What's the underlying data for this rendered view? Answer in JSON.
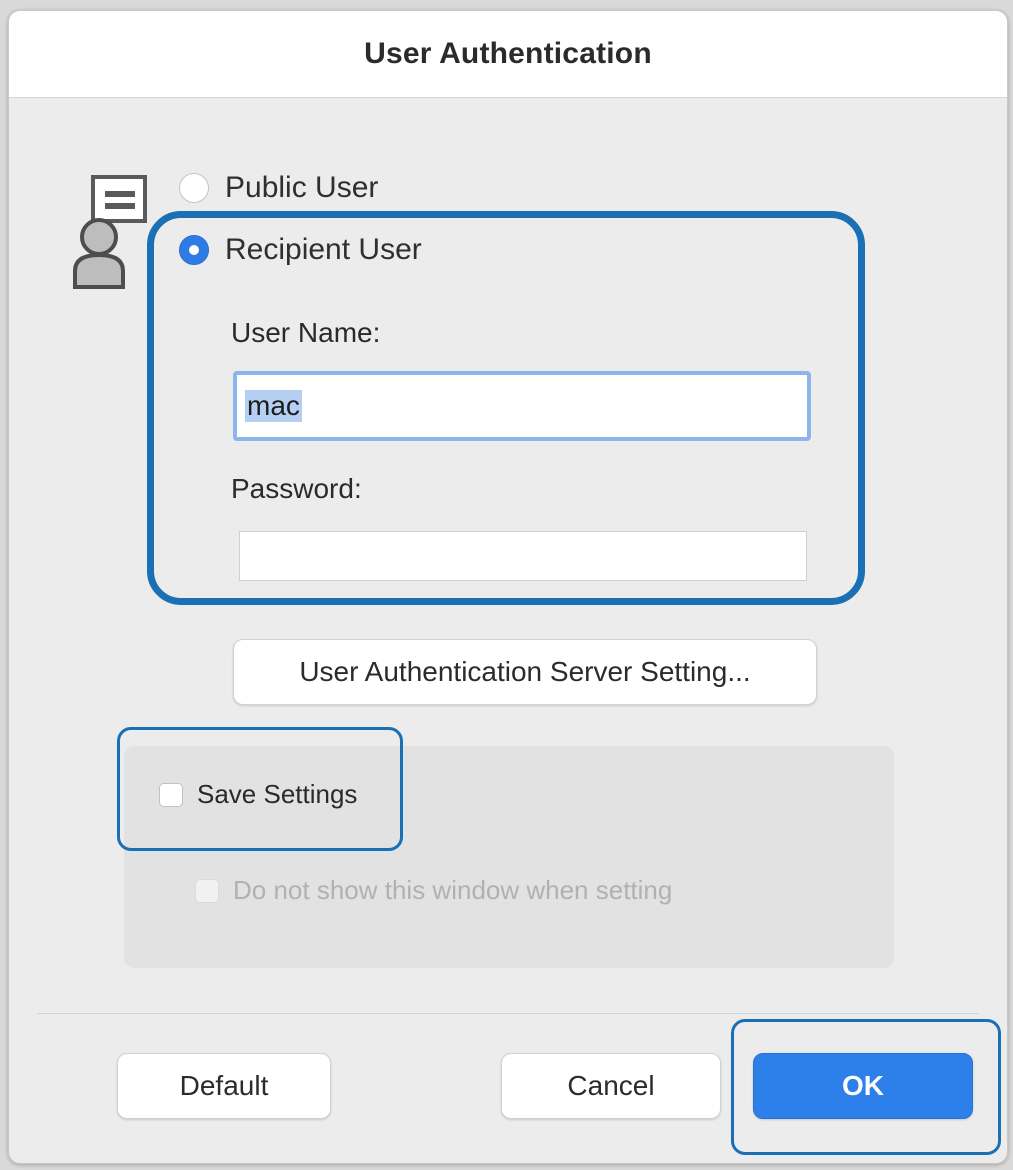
{
  "dialog": {
    "title": "User Authentication"
  },
  "auth_mode": {
    "options": [
      {
        "label": "Public User",
        "selected": false
      },
      {
        "label": "Recipient User",
        "selected": true
      }
    ]
  },
  "fields": {
    "user_name_label": "User Name:",
    "user_name_value": "mac",
    "password_label": "Password:",
    "password_value": ""
  },
  "server_setting_button": "User Authentication Server Setting...",
  "options": {
    "save_settings": {
      "label": "Save Settings",
      "checked": false
    },
    "do_not_show": {
      "label": "Do not show this window when setting",
      "checked": false,
      "enabled": false
    }
  },
  "footer": {
    "default_label": "Default",
    "cancel_label": "Cancel",
    "ok_label": "OK"
  },
  "colors": {
    "accent": "#2d7fea",
    "highlight_outline": "#1a6fb5"
  },
  "icons": {
    "user_auth": "user-with-card-icon"
  }
}
